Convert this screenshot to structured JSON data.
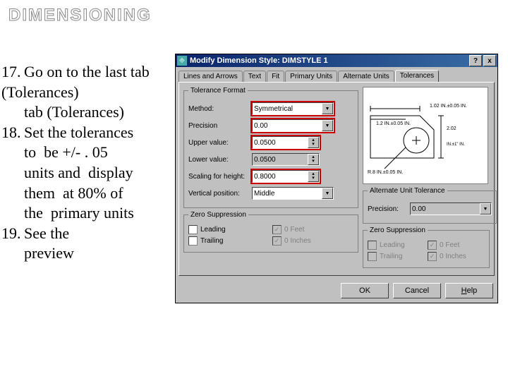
{
  "slide": {
    "title": "DIMENSIONING",
    "steps": [
      {
        "n": "17.",
        "text": "Go on to the last tab (Tolerances)"
      },
      {
        "n": "18.",
        "text": "Set the tolerances to  be +/- . 05 units and  display them  at 80% of the  primary units"
      },
      {
        "n": "19.",
        "text": "See the preview"
      }
    ]
  },
  "window": {
    "title": "Modify Dimension Style: DIMSTYLE 1",
    "help_btn": "?",
    "close_btn": "x",
    "tabs": [
      "Lines and Arrows",
      "Text",
      "Fit",
      "Primary Units",
      "Alternate Units",
      "Tolerances"
    ],
    "active_tab": "Tolerances",
    "tolerance_format": {
      "legend": "Tolerance Format",
      "method_label": "Method:",
      "method_value": "Symmetrical",
      "precision_label": "Precision",
      "precision_value": "0.00",
      "upper_label": "Upper value:",
      "upper_value": "0.0500",
      "lower_label": "Lower value:",
      "lower_value": "0.0500",
      "scaling_label": "Scaling for height:",
      "scaling_value": "0.8000",
      "vpos_label": "Vertical position:",
      "vpos_value": "Middle"
    },
    "zero_suppression": {
      "legend": "Zero Suppression",
      "leading": "Leading",
      "trailing": "Trailing",
      "feet": "0 Feet",
      "inches": "0 Inches"
    },
    "alt_unit_tol": {
      "legend": "Alternate Unit Tolerance",
      "precision_label": "Precision:",
      "precision_value": "0.00"
    },
    "preview_labels": {
      "top": "1.02 IN.±0.05 IN.",
      "mid": "1.2 IN.±0.05 IN.",
      "right1": "2.02",
      "right2": "IN.±1\" IN.",
      "bottom": "R.8 IN.±0.05 IN."
    },
    "buttons": {
      "ok": "OK",
      "cancel": "Cancel",
      "help": "Help"
    }
  }
}
